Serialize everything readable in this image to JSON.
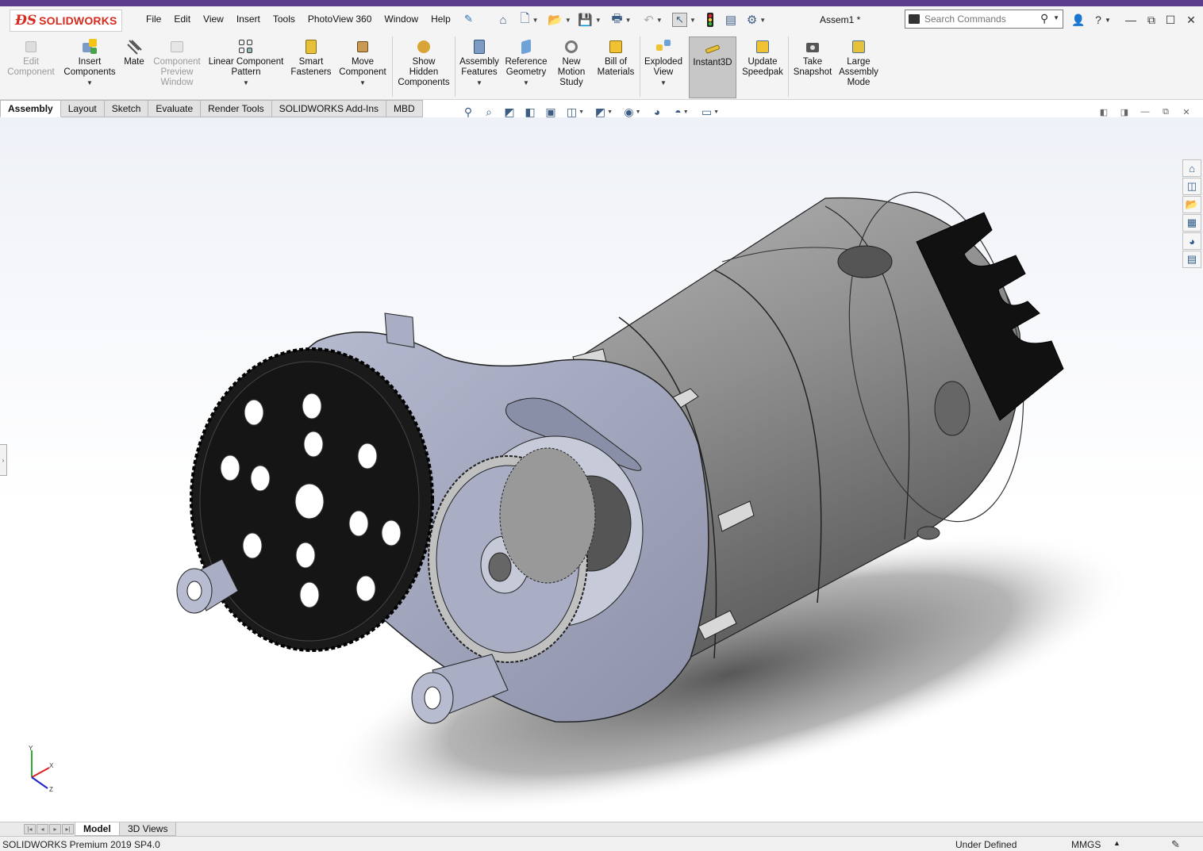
{
  "app": {
    "logo_mark": "ƉS",
    "logo_text": "SOLIDWORKS",
    "document_title": "Assem1 *"
  },
  "menu": [
    "File",
    "Edit",
    "View",
    "Insert",
    "Tools",
    "PhotoView 360",
    "Window",
    "Help"
  ],
  "search": {
    "placeholder": "Search Commands"
  },
  "ribbon": [
    {
      "label": "Edit\nComponent",
      "icon": "edit-component-icon",
      "enabled": false,
      "dropdown": false
    },
    {
      "label": "Insert\nComponents",
      "icon": "insert-components-icon",
      "enabled": true,
      "dropdown": true
    },
    {
      "label": "Mate",
      "icon": "mate-icon",
      "enabled": true,
      "dropdown": false
    },
    {
      "label": "Component\nPreview\nWindow",
      "icon": "component-preview-icon",
      "enabled": false,
      "dropdown": false
    },
    {
      "label": "Linear Component\nPattern",
      "icon": "linear-pattern-icon",
      "enabled": true,
      "dropdown": true
    },
    {
      "label": "Smart\nFasteners",
      "icon": "smart-fasteners-icon",
      "enabled": true,
      "dropdown": false
    },
    {
      "label": "Move\nComponent",
      "icon": "move-component-icon",
      "enabled": true,
      "dropdown": true
    },
    {
      "label": "Show\nHidden\nComponents",
      "icon": "show-hidden-icon",
      "enabled": true,
      "dropdown": false
    },
    {
      "label": "Assembly\nFeatures",
      "icon": "assembly-features-icon",
      "enabled": true,
      "dropdown": true
    },
    {
      "label": "Reference\nGeometry",
      "icon": "reference-geometry-icon",
      "enabled": true,
      "dropdown": true
    },
    {
      "label": "New\nMotion\nStudy",
      "icon": "motion-study-icon",
      "enabled": true,
      "dropdown": false
    },
    {
      "label": "Bill of\nMaterials",
      "icon": "bom-icon",
      "enabled": true,
      "dropdown": false
    },
    {
      "label": "Exploded\nView",
      "icon": "exploded-view-icon",
      "enabled": true,
      "dropdown": true
    },
    {
      "label": "Instant3D",
      "icon": "instant3d-icon",
      "enabled": true,
      "dropdown": false,
      "active": true
    },
    {
      "label": "Update\nSpeedpak",
      "icon": "speedpak-icon",
      "enabled": true,
      "dropdown": false
    },
    {
      "label": "Take\nSnapshot",
      "icon": "snapshot-icon",
      "enabled": true,
      "dropdown": false
    },
    {
      "label": "Large\nAssembly\nMode",
      "icon": "large-assembly-icon",
      "enabled": true,
      "dropdown": false
    }
  ],
  "tabs": [
    {
      "label": "Assembly",
      "active": true
    },
    {
      "label": "Layout",
      "active": false
    },
    {
      "label": "Sketch",
      "active": false
    },
    {
      "label": "Evaluate",
      "active": false
    },
    {
      "label": "Render Tools",
      "active": false
    },
    {
      "label": "SOLIDWORKS Add-Ins",
      "active": false
    },
    {
      "label": "MBD",
      "active": false
    }
  ],
  "bottom_tabs": [
    {
      "label": "Model",
      "active": true
    },
    {
      "label": "3D Views",
      "active": false
    }
  ],
  "status": {
    "product": "SOLIDWORKS Premium 2019 SP4.0",
    "state": "Under Defined",
    "units": "MMGS"
  },
  "colors": {
    "accent": "#5b3b8c",
    "brand_red": "#d52b1e",
    "part_metal": "#8a8a8a",
    "part_plate": "#a9aec4",
    "gear_black": "#1a1a1a"
  }
}
